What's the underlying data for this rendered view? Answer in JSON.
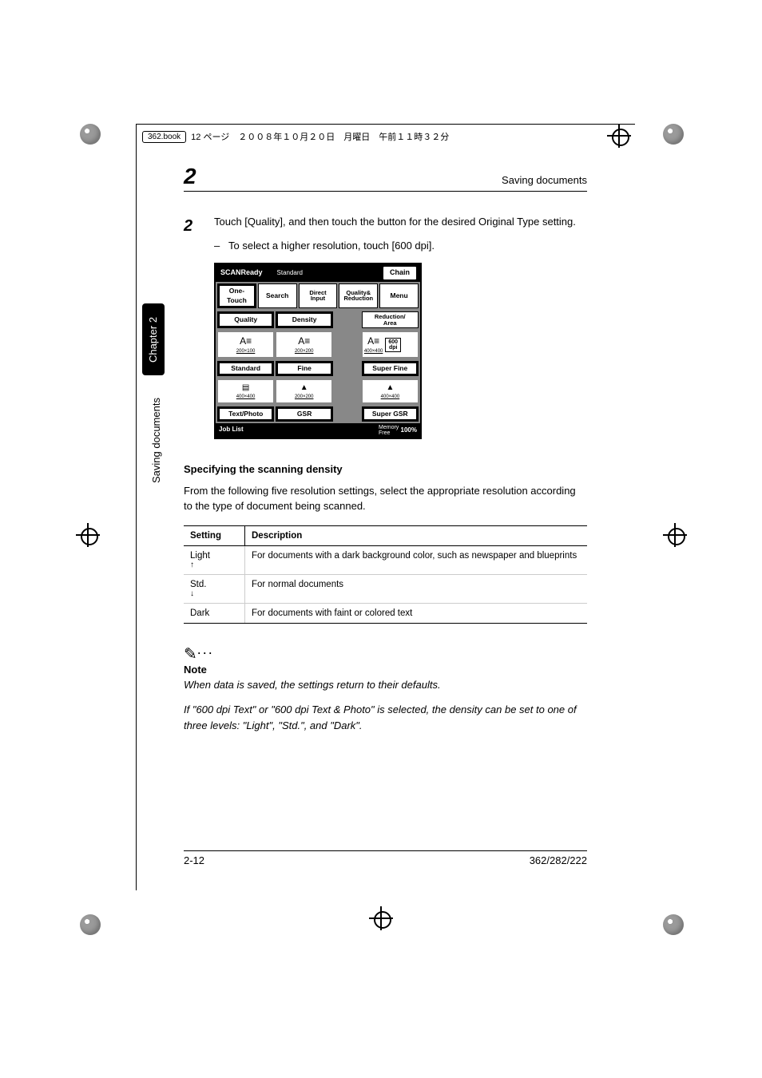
{
  "print_header": {
    "file": "362.book",
    "page_jp": "12 ページ　２００８年１０月２０日　月曜日　午前１１時３２分"
  },
  "running_head": {
    "number": "2",
    "title": "Saving documents"
  },
  "side_tab": "Chapter 2",
  "side_label": "Saving documents",
  "step": {
    "number": "2",
    "text": "Touch [Quality], and then touch the button for the desired Original Type setting.",
    "sub": "To select a higher resolution, touch [600 dpi]."
  },
  "lcd": {
    "title": "SCANReady",
    "subtitle": "Standard",
    "chain": "Chain",
    "tabs": [
      "One-Touch",
      "Search",
      "Direct\nInput",
      "Quality&\nReduction",
      "Menu"
    ],
    "row2": [
      "Quality",
      "Density",
      "Reduction/\nArea"
    ],
    "iconRow": {
      "a": "200×100",
      "b": "200×200",
      "c": "400×400",
      "dpi": "600\ndpi"
    },
    "row3": [
      "Standard",
      "Fine",
      "Super Fine"
    ],
    "iconRow2": {
      "a": "400×400",
      "b": "200×200",
      "c": "400×400"
    },
    "row4": [
      "Text/Photo",
      "GSR",
      "Super GSR"
    ],
    "footer": {
      "job": "Job List",
      "memLabel": "Memory\nFree",
      "memVal": "100%"
    }
  },
  "section_heading": "Specifying the scanning density",
  "section_para": "From the following five resolution settings, select the appropriate resolution according to the type of document being scanned.",
  "table": {
    "headers": [
      "Setting",
      "Description"
    ],
    "rows": [
      {
        "s": "Light",
        "arrow": "up",
        "d": "For documents with a dark background color, such as newspaper and blueprints"
      },
      {
        "s": "Std.",
        "arrow": "down",
        "d": "For normal documents"
      },
      {
        "s": "Dark",
        "arrow": "",
        "d": "For documents with faint or colored text"
      }
    ]
  },
  "note": {
    "label": "Note",
    "body1": "When data is saved, the settings return to their defaults.",
    "body2": "If \"600 dpi Text\" or \"600 dpi Text & Photo\" is selected, the density can be set to one of three levels: \"Light\", \"Std.\", and \"Dark\"."
  },
  "footer": {
    "left": "2-12",
    "right": "362/282/222"
  }
}
